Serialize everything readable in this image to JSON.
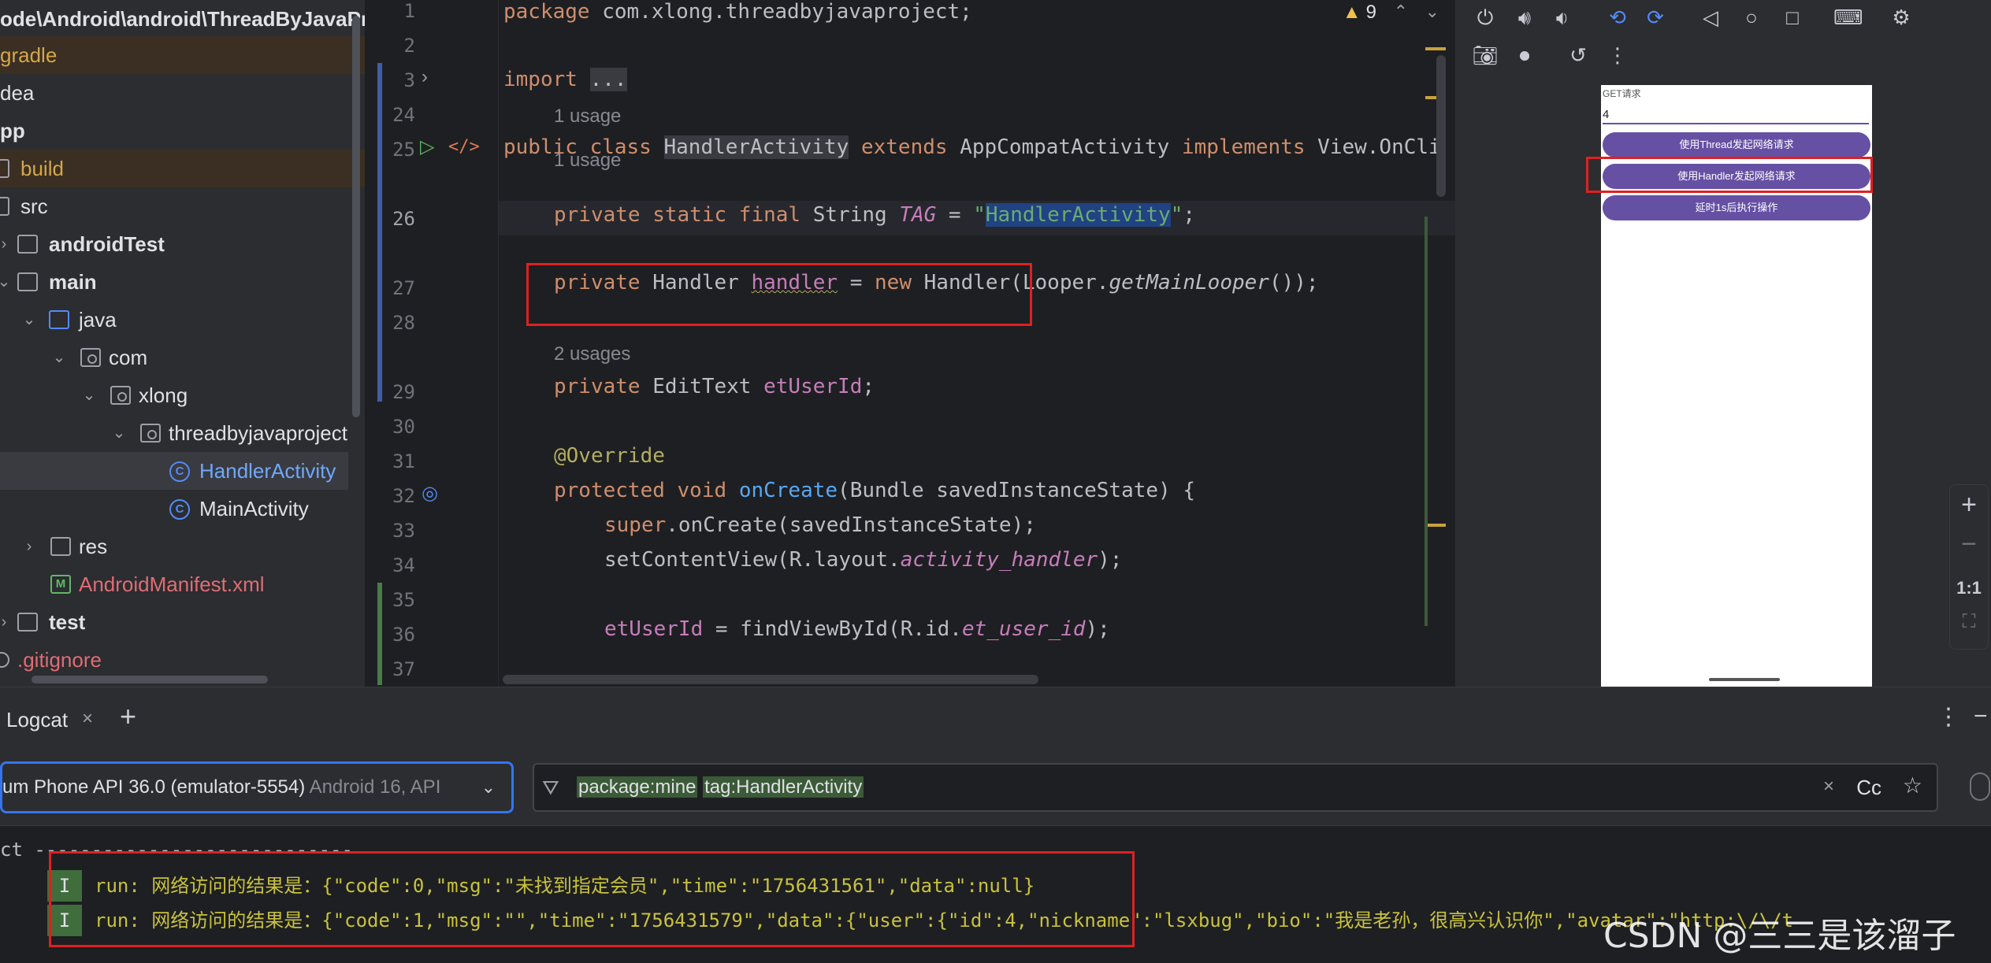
{
  "project_tree": {
    "path": "ode\\Android\\android\\ThreadByJavaPr",
    "items": [
      {
        "label": "gradle",
        "style": "excluded"
      },
      {
        "label": "dea"
      },
      {
        "label": "pp",
        "style": "bold"
      },
      {
        "label": "build",
        "style": "excluded"
      },
      {
        "label": "src"
      },
      {
        "label": "androidTest",
        "style": "bold"
      },
      {
        "label": "main",
        "style": "bold"
      },
      {
        "label": "java"
      },
      {
        "label": "com"
      },
      {
        "label": "xlong"
      },
      {
        "label": "threadbyjavaproject"
      },
      {
        "label": "HandlerActivity",
        "style": "selected"
      },
      {
        "label": "MainActivity"
      },
      {
        "label": "res"
      },
      {
        "label": "AndroidManifest.xml",
        "style": "red"
      },
      {
        "label": "test",
        "style": "bold"
      },
      {
        "label": ".gitignore",
        "style": "red"
      }
    ]
  },
  "editor": {
    "warnings_count": "9",
    "lines": {
      "l1": "1",
      "l2": "2",
      "l3": "3",
      "l24": "24",
      "l25": "25",
      "l26": "26",
      "l27": "27",
      "l28": "28",
      "l29": "29",
      "l30": "30",
      "l31": "31",
      "l32": "32",
      "l33": "33",
      "l34": "34",
      "l35": "35",
      "l36": "36",
      "l37": "37"
    },
    "usage_hints": {
      "h1": "1 usage",
      "h2": "1 usage",
      "h3": "2 usages"
    }
  },
  "emulator": {
    "screen": {
      "label": "GET请求",
      "input_value": "4",
      "buttons": [
        "使用Thread发起网络请求",
        "使用Handler发起网络请求",
        "延时1s后执行操作"
      ]
    },
    "zoom": {
      "reset_label": "1:1"
    }
  },
  "logcat": {
    "tab_label": "Logcat",
    "device": {
      "name": "um Phone API 36.0 (emulator-5554)",
      "version": "Android 16, API"
    },
    "filter": {
      "tokens": [
        "package:mine",
        "tag:HandlerActivity"
      ],
      "case_label": "Cc"
    },
    "separator": "ct ----------------------------",
    "rows": [
      {
        "level": "I",
        "text": "run: 网络访问的结果是：{\"code\":0,\"msg\":\"未找到指定会员\",\"time\":\"1756431561\",\"data\":null}"
      },
      {
        "level": "I",
        "text": "run: 网络访问的结果是：{\"code\":1,\"msg\":\"\",\"time\":\"1756431579\",\"data\":{\"user\":{\"id\":4,\"nickname\":\"lsxbug\",\"bio\":\"我是老孙，很高兴认识你\",\"avatar\":\"http:\\/\\/t"
      }
    ]
  },
  "watermark": "CSDN @三三是该溜子",
  "colors": {
    "accent": "#3574f0",
    "annotation_box": "#e02020",
    "phone_button": "#6650a4"
  }
}
